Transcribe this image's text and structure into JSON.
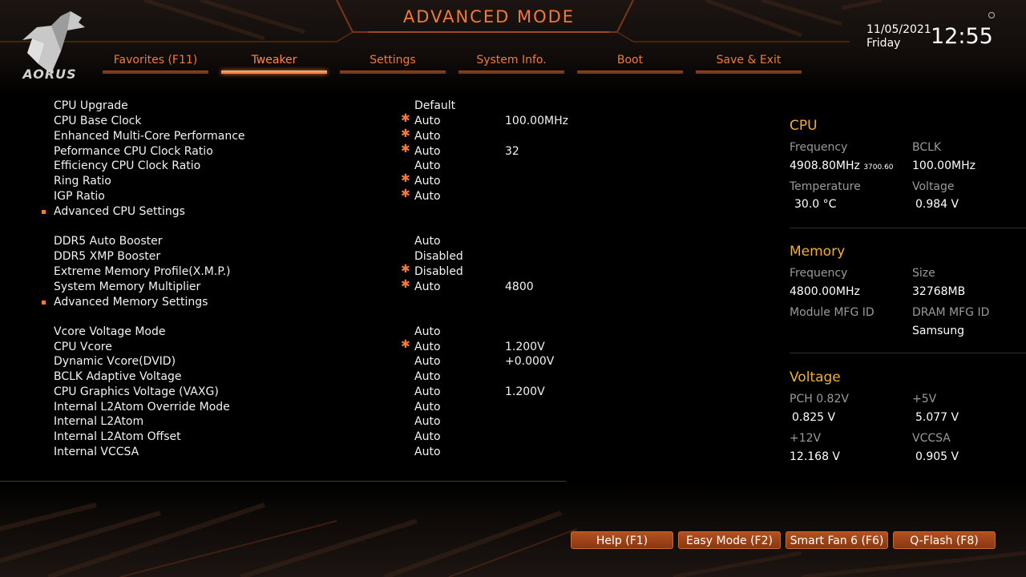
{
  "brand": {
    "logo_text": "AORUS"
  },
  "header": {
    "title": "ADVANCED MODE",
    "date": "11/05/2021",
    "day": "Friday",
    "time": "12:55"
  },
  "tabs": [
    {
      "label": "Favorites (F11)",
      "active": false
    },
    {
      "label": "Tweaker",
      "active": true
    },
    {
      "label": "Settings",
      "active": false
    },
    {
      "label": "System Info.",
      "active": false
    },
    {
      "label": "Boot",
      "active": false
    },
    {
      "label": "Save & Exit",
      "active": false
    }
  ],
  "settings": {
    "cpu_upgrade": {
      "label": "CPU Upgrade",
      "value": "Default",
      "extra": "",
      "modified": false
    },
    "cpu_base_clock": {
      "label": "CPU Base Clock",
      "value": "Auto",
      "extra": "100.00MHz",
      "modified": true
    },
    "enhanced_mc_perf": {
      "label": "Enhanced Multi-Core Performance",
      "value": "Auto",
      "extra": "",
      "modified": true
    },
    "perf_cpu_ratio": {
      "label": "Peformance CPU Clock Ratio",
      "value": "Auto",
      "extra": "32",
      "modified": true
    },
    "eff_cpu_ratio": {
      "label": "Efficiency CPU Clock Ratio",
      "value": "Auto",
      "extra": "",
      "modified": false
    },
    "ring_ratio": {
      "label": "Ring Ratio",
      "value": "Auto",
      "extra": "",
      "modified": true
    },
    "igp_ratio": {
      "label": "IGP Ratio",
      "value": "Auto",
      "extra": "",
      "modified": true
    },
    "adv_cpu": {
      "label": "Advanced CPU Settings"
    },
    "ddr5_auto_booster": {
      "label": "DDR5 Auto Booster",
      "value": "Auto",
      "extra": "",
      "modified": false
    },
    "ddr5_xmp_booster": {
      "label": "DDR5 XMP Booster",
      "value": "Disabled",
      "extra": "",
      "modified": false
    },
    "xmp_profile": {
      "label": "Extreme Memory Profile(X.M.P.)",
      "value": "Disabled",
      "extra": "",
      "modified": true
    },
    "sys_mem_mult": {
      "label": "System Memory Multiplier",
      "value": "Auto",
      "extra": "4800",
      "modified": true
    },
    "adv_mem": {
      "label": "Advanced Memory Settings"
    },
    "vcore_mode": {
      "label": "Vcore Voltage Mode",
      "value": "Auto",
      "extra": "",
      "modified": false
    },
    "cpu_vcore": {
      "label": "CPU Vcore",
      "value": "Auto",
      "extra": "1.200V",
      "modified": true
    },
    "dyn_vcore": {
      "label": "Dynamic Vcore(DVID)",
      "value": "Auto",
      "extra": "+0.000V",
      "modified": false
    },
    "bclk_adaptive": {
      "label": "BCLK Adaptive Voltage",
      "value": "Auto",
      "extra": "",
      "modified": false
    },
    "cpu_gfx_voltage": {
      "label": "CPU Graphics Voltage (VAXG)",
      "value": "Auto",
      "extra": "1.200V",
      "modified": false
    },
    "l2atom_override": {
      "label": "Internal L2Atom Override Mode",
      "value": "Auto",
      "extra": "",
      "modified": false
    },
    "l2atom": {
      "label": "Internal L2Atom",
      "value": "Auto",
      "extra": "",
      "modified": false
    },
    "l2atom_offset": {
      "label": "Internal L2Atom Offset",
      "value": "Auto",
      "extra": "",
      "modified": false
    },
    "vccsa": {
      "label": "Internal VCCSA",
      "value": "Auto",
      "extra": "",
      "modified": false
    }
  },
  "modified_marker": "✱",
  "info": {
    "cpu": {
      "title": "CPU",
      "frequency_label": "Frequency",
      "frequency": "4908.80MHz",
      "frequency_sub": "3700.60",
      "bclk_label": "BCLK",
      "bclk": "100.00MHz",
      "temperature_label": "Temperature",
      "temperature": "30.0 °C",
      "voltage_label": "Voltage",
      "voltage": "0.984 V"
    },
    "memory": {
      "title": "Memory",
      "frequency_label": "Frequency",
      "frequency": "4800.00MHz",
      "size_label": "Size",
      "size": "32768MB",
      "module_mfg_label": "Module MFG ID",
      "module_mfg": "",
      "dram_mfg_label": "DRAM MFG ID",
      "dram_mfg": "Samsung"
    },
    "voltage": {
      "title": "Voltage",
      "pch_label": "PCH 0.82V",
      "pch": "0.825 V",
      "v5_label": "+5V",
      "v5": "5.077 V",
      "v12_label": "+12V",
      "v12": "12.168 V",
      "vccsa_label": "VCCSA",
      "vccsa": "0.905 V"
    }
  },
  "footer": {
    "help": "Help (F1)",
    "easy_mode": "Easy Mode (F2)",
    "smart_fan": "Smart Fan 6 (F6)",
    "qflash": "Q-Flash (F8)"
  },
  "colors": {
    "accent": "#f07a38",
    "section_title": "#f0b030",
    "label": "#9a9a9a",
    "button": "#9a4318"
  }
}
